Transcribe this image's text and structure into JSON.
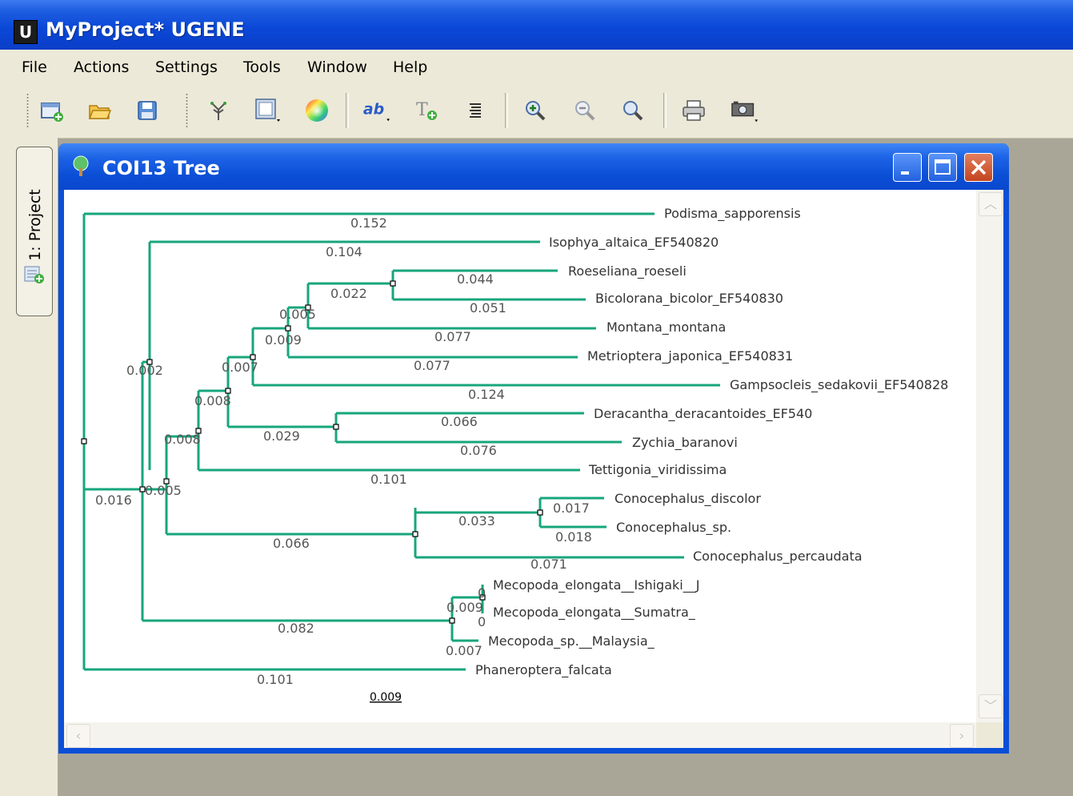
{
  "app": {
    "icon_letter": "U",
    "title": "MyProject* UGENE"
  },
  "menu": [
    "File",
    "Actions",
    "Settings",
    "Tools",
    "Window",
    "Help"
  ],
  "toolbar": {
    "icons": [
      "new-project-icon",
      "open-folder-icon",
      "save-icon",
      "tree-layout-icon",
      "screenshot-layout-icon",
      "color-wheel-icon",
      "text-format-icon",
      "text-settings-icon",
      "align-labels-icon",
      "zoom-in-icon",
      "zoom-out-icon",
      "zoom-reset-icon",
      "print-icon",
      "capture-image-icon"
    ]
  },
  "dock": {
    "project_tab": "1: Project"
  },
  "window": {
    "title": "COI13 Tree"
  },
  "tree": {
    "branch_color": "#17a67c",
    "leaves": [
      "Podisma_sapporensis",
      "Isophya_altaica_EF540820",
      "Roeseliana_roeseli",
      "Bicolorana_bicolor_EF540830",
      "Montana_montana",
      "Metrioptera_japonica_EF540831",
      "Gampsocleis_sedakovii_EF540828",
      "Deracantha_deracantoides_EF540",
      "Zychia_baranovi",
      "Tettigonia_viridissima",
      "Conocephalus_discolor",
      "Conocephalus_sp.",
      "Conocephalus_percaudata",
      "Mecopoda_elongata__Ishigaki__J",
      "Mecopoda_elongata__Sumatra_",
      "Mecopoda_sp.__Malaysia_",
      "Phaneroptera_falcata"
    ],
    "distances": [
      "0.152",
      "0.104",
      "0.044",
      "0.022",
      "0.051",
      "0.005",
      "0.077",
      "0.009",
      "0.077",
      "0.007",
      "0.124",
      "0.002",
      "0.008",
      "0.066",
      "0.029",
      "0.076",
      "0.008",
      "0.101",
      "0.005",
      "0.017",
      "0.033",
      "0.018",
      "0.016",
      "0.066",
      "0.071",
      "0",
      "0.009",
      "0",
      "0.082",
      "0.007",
      "0.101"
    ],
    "scale_bar": "0.009"
  }
}
